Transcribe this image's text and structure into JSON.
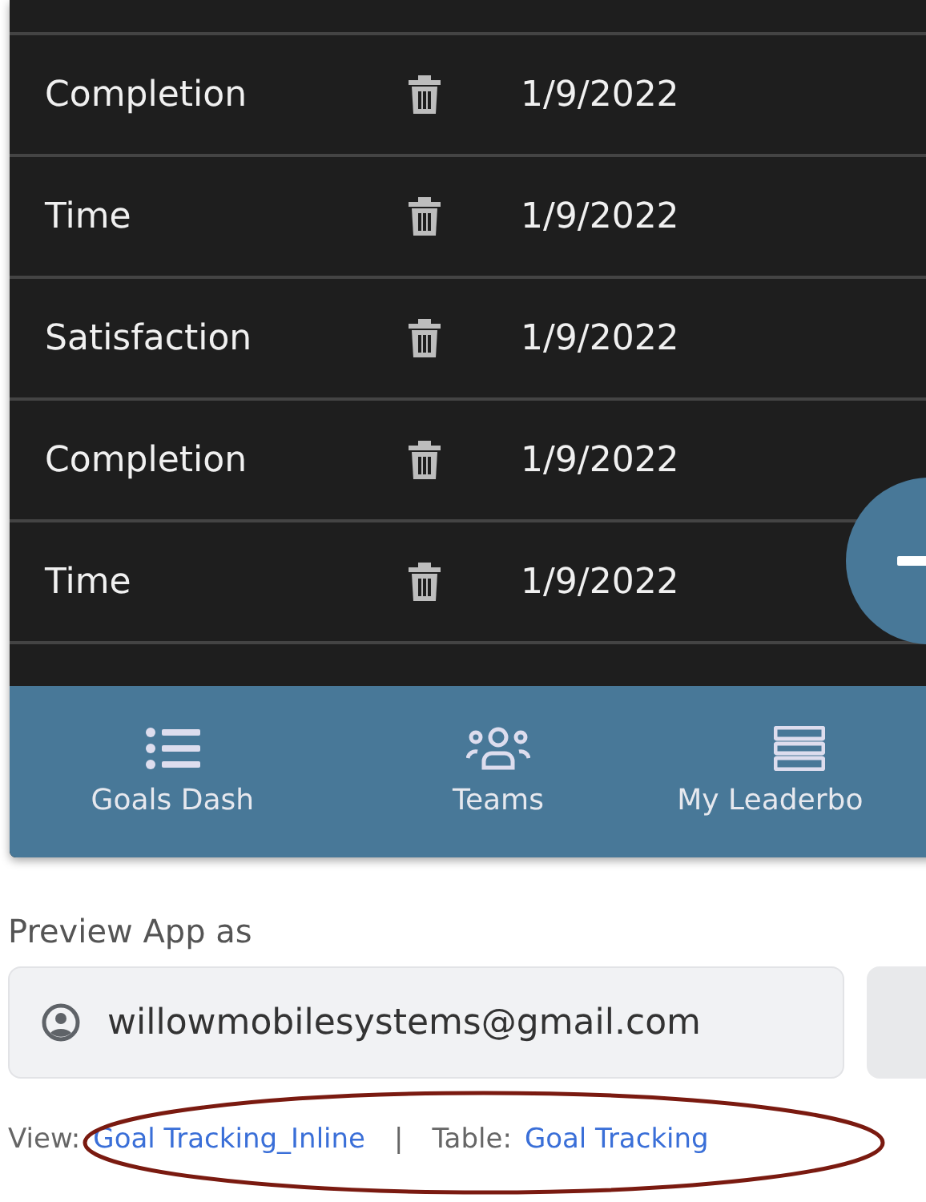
{
  "rows": [
    {
      "name": "Completion",
      "date": "1/9/2022"
    },
    {
      "name": "Time",
      "date": "1/9/2022"
    },
    {
      "name": "Satisfaction",
      "date": "1/9/2022"
    },
    {
      "name": "Completion",
      "date": "1/9/2022"
    },
    {
      "name": "Time",
      "date": "1/9/2022"
    }
  ],
  "nav": [
    {
      "label": "Goals Dash",
      "kind": "list"
    },
    {
      "label": "Teams",
      "kind": "people"
    },
    {
      "label": "My Leaderbo",
      "kind": "table"
    }
  ],
  "preview": {
    "label": "Preview App as",
    "email": "willowmobilesystems@gmail.com"
  },
  "footer": {
    "view_label": "View:",
    "view_link": "Goal Tracking_Inline",
    "separator": "|",
    "table_label": "Table:",
    "table_link": "Goal Tracking"
  }
}
